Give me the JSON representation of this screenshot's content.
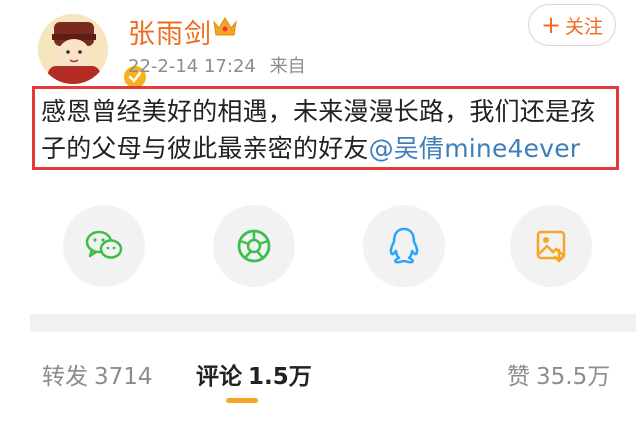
{
  "user": {
    "name": "张雨剑",
    "date": "22-2-14 17:24",
    "source": "来自"
  },
  "follow_button": {
    "plus": "+",
    "label": "关注"
  },
  "post": {
    "text": "感恩曾经美好的相遇，未来漫漫长路，我们还是孩子的父母与彼此最亲密的好友",
    "mention": "@吴倩mine4ever"
  },
  "share": [
    {
      "icon": "wechat-icon",
      "color": "#3cbf4a"
    },
    {
      "icon": "moments-icon",
      "color": "#3cbf4a"
    },
    {
      "icon": "qq-icon",
      "color": "#2aa4f4"
    },
    {
      "icon": "save-image-icon",
      "color": "#f6a623"
    }
  ],
  "stats": {
    "repost": {
      "label": "转发",
      "count": "3714"
    },
    "comment": {
      "label": "评论",
      "count": "1.5万"
    },
    "like": {
      "label": "赞",
      "count": "35.5万"
    }
  },
  "colors": {
    "username": "#f26b1d",
    "highlight_border": "#e63a3a",
    "mention": "#3d7fb8",
    "tab_indicator": "#f6a623"
  }
}
